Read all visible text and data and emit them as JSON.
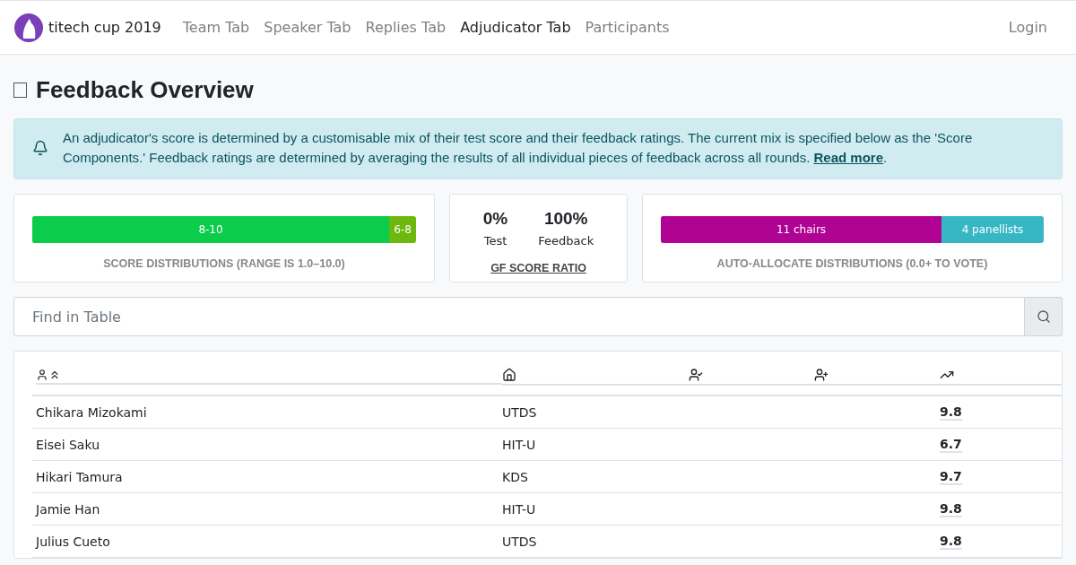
{
  "brand": "titech cup 2019",
  "nav": [
    {
      "label": "Team Tab",
      "selected": false
    },
    {
      "label": "Speaker Tab",
      "selected": false
    },
    {
      "label": "Replies Tab",
      "selected": false
    },
    {
      "label": "Adjudicator Tab",
      "selected": true
    },
    {
      "label": "Participants",
      "selected": false
    }
  ],
  "login": "Login",
  "title": "Feedback Overview",
  "alert": {
    "text": "An adjudicator's score is determined by a customisable mix of their test score and their feedback ratings. The current mix is specified below as the 'Score Components.' Feedback ratings are determined by averaging the results of all individual pieces of feedback across all rounds.",
    "link": "Read more",
    "after": "."
  },
  "score_distribution": {
    "level": 0.93,
    "fill_label": "8-10",
    "rest_label": "6-8",
    "caption": "SCORE DISTRIBUTIONS (RANGE IS 1.0–10.0)"
  },
  "ratio": {
    "items": [
      {
        "value": "0%",
        "label": "Test"
      },
      {
        "value": "100%",
        "label": "Feedback"
      }
    ],
    "caption": "GF SCORE RATIO"
  },
  "allocation": {
    "level": 0.733,
    "fill_label": "11 chairs",
    "rest_label": "4 panellists",
    "caption": "AUTO-ALLOCATE DISTRIBUTIONS (0.0+ TO VOTE)"
  },
  "search": {
    "placeholder": "Find in Table"
  },
  "table": {
    "rows": [
      {
        "name": "Chikara Mizokami",
        "institution": "UTDS",
        "score": "9.8"
      },
      {
        "name": "Eisei Saku",
        "institution": "HIT-U",
        "score": "6.7"
      },
      {
        "name": "Hikari Tamura",
        "institution": "KDS",
        "score": "9.7"
      },
      {
        "name": "Jamie Han",
        "institution": "HIT-U",
        "score": "9.8"
      },
      {
        "name": "Julius Cueto",
        "institution": "UTDS",
        "score": "9.8"
      }
    ]
  }
}
